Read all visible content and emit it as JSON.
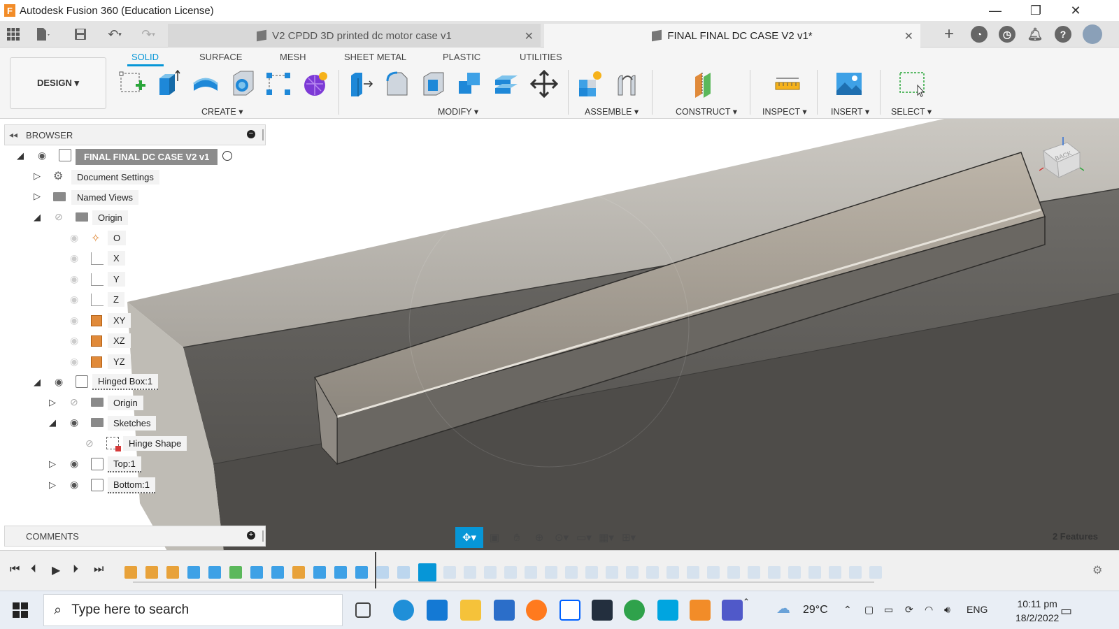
{
  "window": {
    "title": "Autodesk Fusion 360 (Education License)",
    "app_letter": "F"
  },
  "tabs": {
    "inactive_title": "V2 CPDD 3D printed dc motor case v1",
    "active_title": "FINAL FINAL DC CASE V2 v1*"
  },
  "workspace": {
    "design_label": "DESIGN ▾",
    "tabs": [
      "SOLID",
      "SURFACE",
      "MESH",
      "SHEET METAL",
      "PLASTIC",
      "UTILITIES"
    ],
    "groups": [
      "CREATE ▾",
      "MODIFY ▾",
      "ASSEMBLE ▾",
      "CONSTRUCT ▾",
      "INSPECT ▾",
      "INSERT ▾",
      "SELECT ▾"
    ]
  },
  "browser": {
    "header": "BROWSER",
    "root": "FINAL FINAL DC CASE V2 v1",
    "items": {
      "document_settings": "Document Settings",
      "named_views": "Named Views",
      "origin": "Origin",
      "o": "O",
      "x": "X",
      "y": "Y",
      "z": "Z",
      "xy": "XY",
      "xz": "XZ",
      "yz": "YZ",
      "hinged_box": "Hinged Box:1",
      "sub_origin": "Origin",
      "sketches": "Sketches",
      "hinge_shape": "Hinge Shape",
      "top": "Top:1",
      "bottom": "Bottom:1"
    }
  },
  "viewcube": {
    "face_label": "BACK"
  },
  "comments": {
    "header": "COMMENTS"
  },
  "status": {
    "features": "2 Features"
  },
  "taskbar": {
    "search_placeholder": "Type here to search",
    "weather": "29°C",
    "language": "ENG",
    "time": "10:11 pm",
    "date": "18/2/2022"
  },
  "colors": {
    "accent": "#0696d7",
    "fusion_orange": "#f28c28"
  }
}
